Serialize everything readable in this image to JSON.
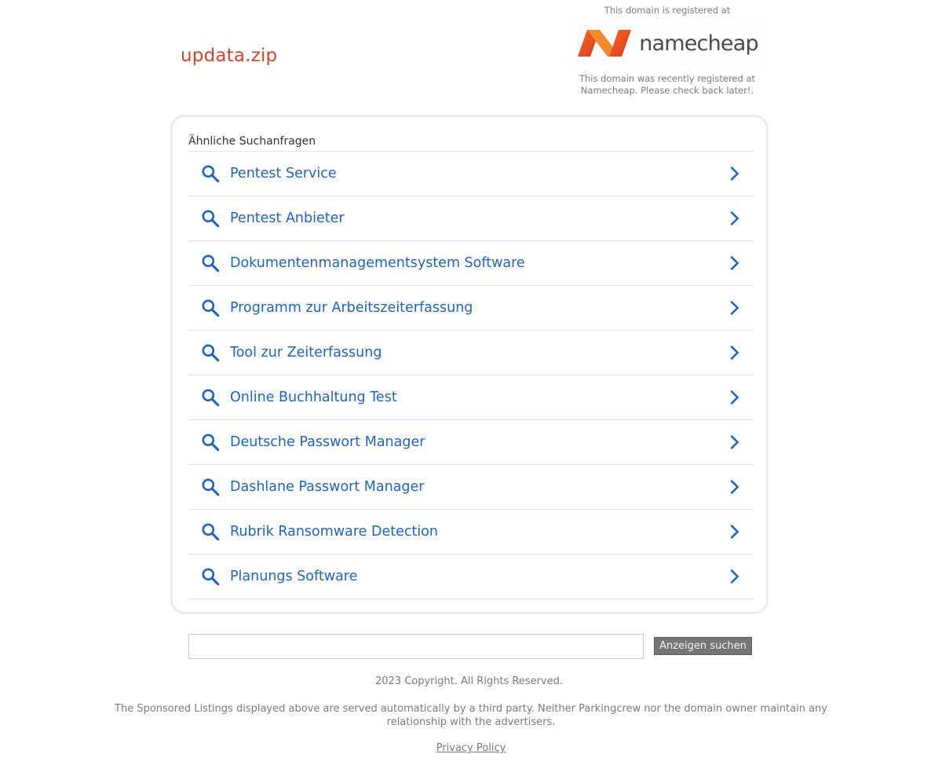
{
  "header": {
    "domain": "updata.zip",
    "registrar_intro": "This domain is registered at",
    "registrar_name": "namecheap",
    "registrar_note": "This domain was recently registered at Namecheap. Please check back later!."
  },
  "related": {
    "heading": "Ähnliche Suchanfragen",
    "items": [
      {
        "label": "Pentest Service"
      },
      {
        "label": "Pentest Anbieter"
      },
      {
        "label": "Dokumentenmanagementsystem Software"
      },
      {
        "label": "Programm zur Arbeitszeiterfassung"
      },
      {
        "label": "Tool zur Zeiterfassung"
      },
      {
        "label": "Online Buchhaltung Test"
      },
      {
        "label": "Deutsche Passwort Manager"
      },
      {
        "label": "Dashlane Passwort Manager"
      },
      {
        "label": "Rubrik Ransomware Detection"
      },
      {
        "label": "Planungs Software"
      }
    ]
  },
  "search": {
    "value": "",
    "button_label": "Anzeigen suchen"
  },
  "footer": {
    "copyright": "2023 Copyright. All Rights Reserved.",
    "disclaimer": "The Sponsored Listings displayed above are served automatically by a third party. Neither Parkingcrew nor the domain owner maintain any relationship with the advertisers.",
    "privacy_label": "Privacy Policy"
  },
  "colors": {
    "domain_title": "#d8432c",
    "link_blue": "#1a64c8",
    "logo_orange": "#ef5a22",
    "button_gray": "#757575"
  },
  "icons": {
    "search": "search-icon",
    "chevron": "chevron-right-icon"
  }
}
